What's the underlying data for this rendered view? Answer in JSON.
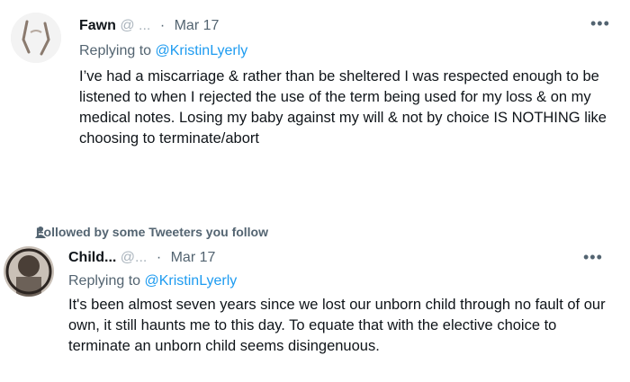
{
  "tweets": [
    {
      "author_name": "Fawn",
      "author_handle": "@ ... ",
      "date": "Mar 17",
      "replying_prefix": "Replying to ",
      "replying_to": "@KristinLyerly",
      "text": "I’ve had a miscarriage & rather than be sheltered I was respected enough to be listened to when I rejected the use of the term being used for my loss & on my medical notes. Losing my baby against my will & not by choice IS NOTHING like choosing to terminate/abort",
      "more_label": "•••"
    },
    {
      "social_context": "Followed by some Tweeters you follow",
      "author_name": "Child...",
      "author_handle": "@...",
      "date": "Mar 17",
      "replying_prefix": "Replying to ",
      "replying_to": "@KristinLyerly",
      "text": "It's been almost seven years since we lost our unborn child through no fault of our own, it still haunts me to this day. To equate that with the elective choice to terminate an unborn child seems disingenuous.",
      "more_label": "•••"
    }
  ],
  "icons": {
    "more": "more-icon",
    "person": "person-icon"
  }
}
